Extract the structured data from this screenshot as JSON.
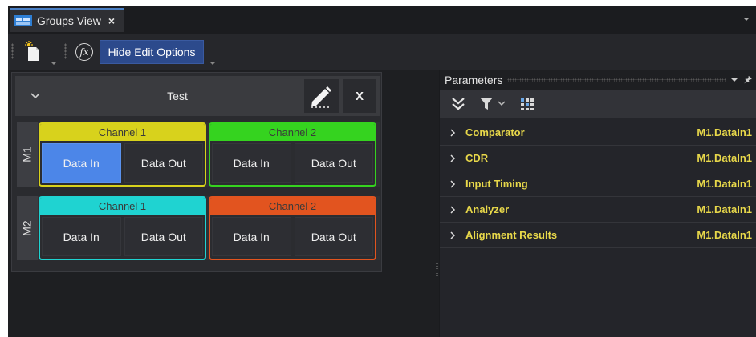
{
  "tab": {
    "title": "Groups View",
    "close_glyph": "×",
    "icon": "groups-view-icon"
  },
  "toolbar": {
    "new_icon": "new-document-icon",
    "fx_label": "fx",
    "hide_edit_label": "Hide Edit Options",
    "accent": "#2c4a8c"
  },
  "group": {
    "title": "Test",
    "close_label": "X",
    "modules": [
      {
        "label": "M1",
        "channels": [
          {
            "title": "Channel 1",
            "color": "#d8d21c",
            "buttons": [
              "Data In",
              "Data Out"
            ],
            "active": 0
          },
          {
            "title": "Channel 2",
            "color": "#35d31f",
            "buttons": [
              "Data In",
              "Data Out"
            ],
            "active": -1
          }
        ]
      },
      {
        "label": "M2",
        "channels": [
          {
            "title": "Channel 1",
            "color": "#1fd3d1",
            "buttons": [
              "Data In",
              "Data Out"
            ],
            "active": -1
          },
          {
            "title": "Channel 2",
            "color": "#e2541f",
            "buttons": [
              "Data In",
              "Data Out"
            ],
            "active": -1
          }
        ]
      }
    ],
    "active_button_color": "#4c86e8"
  },
  "parameters": {
    "title": "Parameters",
    "items": [
      {
        "name": "Comparator",
        "value": "M1.DataIn1"
      },
      {
        "name": "CDR",
        "value": "M1.DataIn1"
      },
      {
        "name": "Input Timing",
        "value": "M1.DataIn1"
      },
      {
        "name": "Analyzer",
        "value": "M1.DataIn1"
      },
      {
        "name": "Alignment Results",
        "value": "M1.DataIn1"
      }
    ],
    "text_color": "#e8d84a"
  }
}
